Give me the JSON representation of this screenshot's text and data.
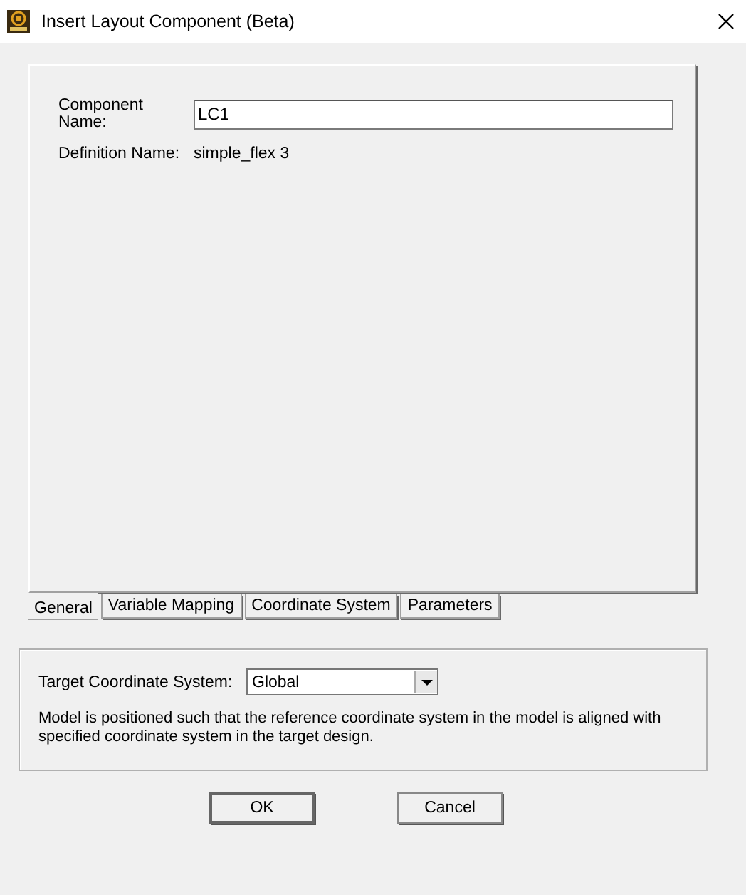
{
  "window": {
    "title": "Insert Layout Component (Beta)"
  },
  "general": {
    "component_name_label": "Component Name:",
    "component_name_value": "LC1",
    "definition_name_label": "Definition Name:",
    "definition_name_value": "simple_flex 3"
  },
  "tabs": [
    {
      "label": "General",
      "selected": true
    },
    {
      "label": "Variable Mapping",
      "selected": false
    },
    {
      "label": "Coordinate System",
      "selected": false
    },
    {
      "label": "Parameters",
      "selected": false
    }
  ],
  "target": {
    "label": "Target Coordinate System:",
    "value": "Global",
    "description": "Model is positioned such that the reference coordinate system in the model is aligned with specified coordinate system in the target design."
  },
  "buttons": [
    "OK",
    "Cancel"
  ]
}
